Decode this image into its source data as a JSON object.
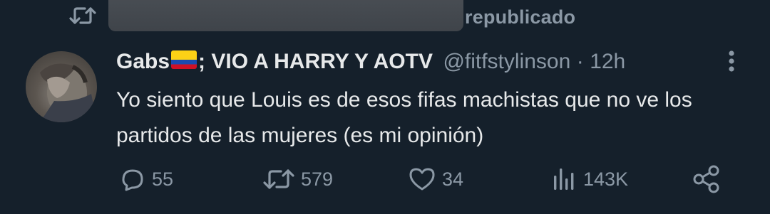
{
  "repost": {
    "label": "republicado"
  },
  "tweet": {
    "display_name_part1": "Gabs",
    "flag": "colombia-flag",
    "display_name_part2": "; VIO A HARRY Y AOTV",
    "handle": "@fitfstylinson",
    "separator": "·",
    "time": "12h",
    "text": "Yo siento que Louis es de esos fifas machistas que no ve los partidos de las mujeres (es mi opinión)"
  },
  "actions": {
    "replies": "55",
    "reposts": "579",
    "likes": "34",
    "views": "143K"
  },
  "colors": {
    "background": "#15202b",
    "primary_text": "#e7e9ea",
    "secondary_text": "#8b98a5"
  },
  "icons": [
    "repost-icon",
    "more-icon",
    "reply-icon",
    "like-icon",
    "views-icon",
    "share-icon"
  ]
}
